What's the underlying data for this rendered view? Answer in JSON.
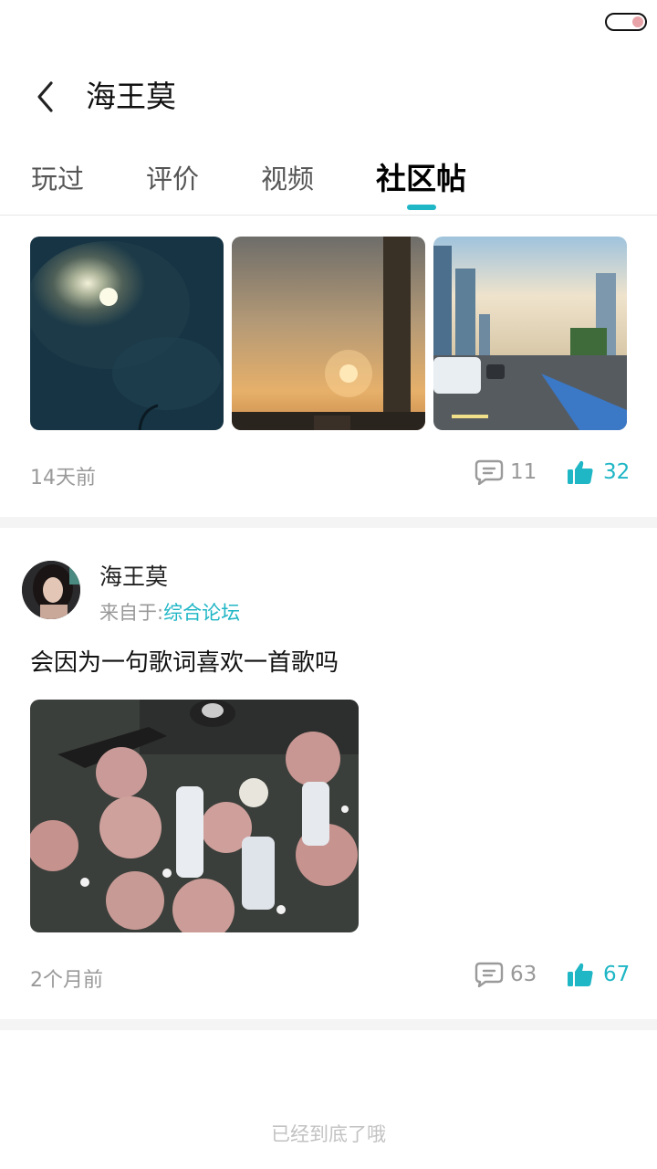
{
  "header": {
    "title": "海王莫",
    "back_icon": "chevron-left-icon"
  },
  "tabs": [
    {
      "label": "玩过",
      "active": false
    },
    {
      "label": "评价",
      "active": false
    },
    {
      "label": "视频",
      "active": false
    },
    {
      "label": "社区帖",
      "active": true
    }
  ],
  "posts": [
    {
      "images": [
        "moon-clouds-night",
        "sunset-chimney",
        "city-street-traffic"
      ],
      "time": "14天前",
      "comments": "11",
      "likes": "32"
    },
    {
      "author": "海王莫",
      "source_prefix": "来自于:",
      "source_forum": "综合论坛",
      "text": "会因为一句歌词喜欢一首歌吗",
      "images": [
        "roses-and-bottles"
      ],
      "time": "2个月前",
      "comments": "63",
      "likes": "67"
    }
  ],
  "footer": {
    "end_text": "已经到底了哦"
  },
  "colors": {
    "accent": "#1fb6c5",
    "muted": "#999999"
  }
}
